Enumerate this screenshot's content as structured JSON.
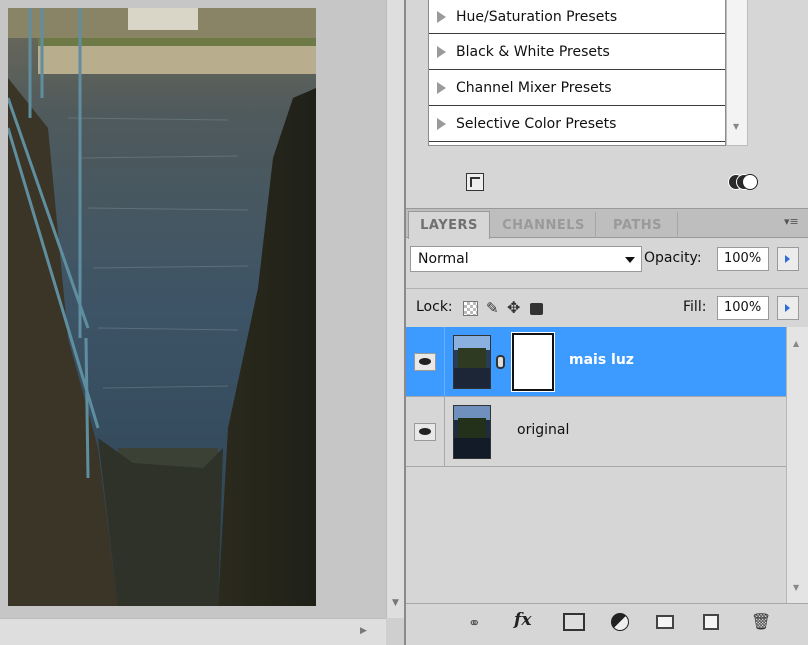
{
  "presets": {
    "items": [
      {
        "label": "Hue/Saturation Presets"
      },
      {
        "label": "Black & White Presets"
      },
      {
        "label": "Channel Mixer Presets"
      },
      {
        "label": "Selective Color Presets"
      }
    ]
  },
  "layers_panel": {
    "tabs": [
      {
        "label": "LAYERS",
        "active": true
      },
      {
        "label": "CHANNELS",
        "active": false
      },
      {
        "label": "PATHS",
        "active": false
      }
    ],
    "blend_mode": "Normal",
    "opacity_label": "Opacity:",
    "opacity_value": "100%",
    "lock_label": "Lock:",
    "fill_label": "Fill:",
    "fill_value": "100%",
    "layers": [
      {
        "name": "mais luz",
        "selected": true,
        "visible": true,
        "has_mask": true
      },
      {
        "name": "original",
        "selected": false,
        "visible": true,
        "has_mask": false
      }
    ],
    "footer_icons": [
      "link-layers-icon",
      "fx-icon",
      "add-mask-icon",
      "adjustment-layer-icon",
      "new-group-icon",
      "new-layer-icon",
      "trash-icon"
    ],
    "fx_label": "fx"
  },
  "colors": {
    "selection": "#3d9bff",
    "panel_bg": "#d6d6d6",
    "canvas_bg": "#c6c6c6"
  }
}
